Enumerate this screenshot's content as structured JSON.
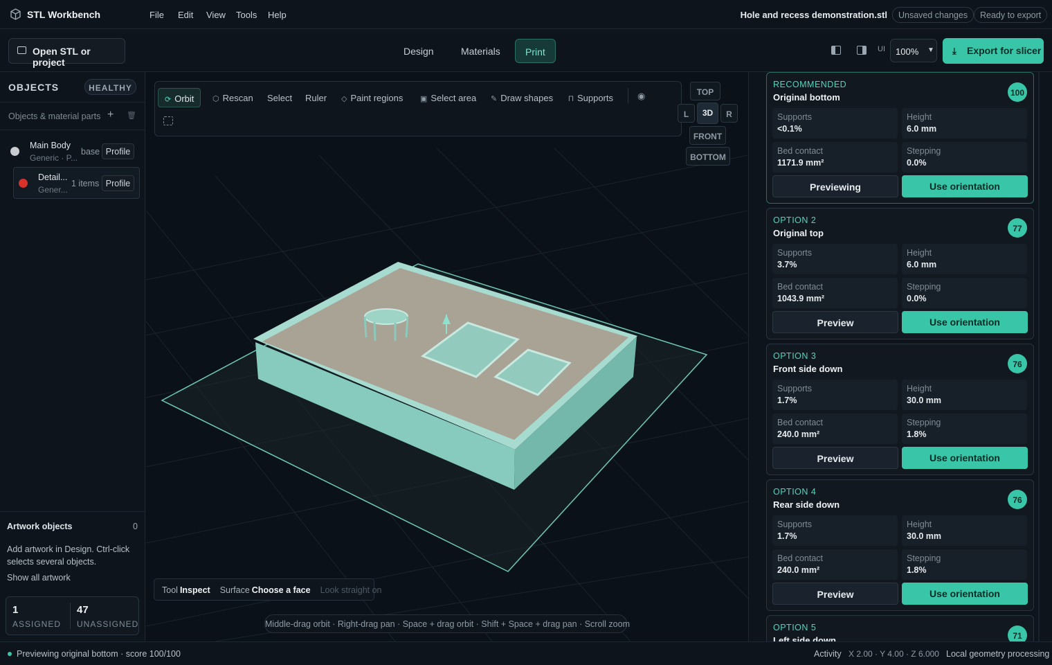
{
  "app": {
    "name": "STL Workbench",
    "file_name": "Hole and recess demonstration.stl",
    "unsaved": "Unsaved changes",
    "ready": "Ready to export"
  },
  "menu": [
    "File",
    "Edit",
    "View",
    "Tools",
    "Help"
  ],
  "toolbar": {
    "open_label": "Open STL or project",
    "tabs": [
      "Design",
      "Materials",
      "Print"
    ],
    "active_tab": "Print",
    "ui_label": "UI",
    "zoom": "100%",
    "export_label": "Export for slicer"
  },
  "sidebar": {
    "title": "OBJECTS",
    "health": "HEALTHY",
    "subtitle": "Objects & material parts",
    "objects": [
      {
        "name": "Main Body",
        "material": "Generic · P...",
        "tag": "base",
        "profile": "Profile",
        "color": "#c9cdd1"
      },
      {
        "name": "Detail...",
        "material": "Gener...",
        "tag": "1 items",
        "profile": "Profile",
        "color": "#d8322b"
      }
    ],
    "artwork": {
      "title": "Artwork objects",
      "count": "0",
      "help": "Add artwork in Design. Ctrl-click selects several objects.",
      "link": "Show all artwork"
    },
    "counts": {
      "assigned": "1",
      "assigned_label": "ASSIGNED",
      "unassigned": "47",
      "unassigned_label": "UNASSIGNED"
    }
  },
  "viewport": {
    "tools": [
      "Orbit",
      "Rescan",
      "Select",
      "Ruler",
      "Paint regions",
      "Select area",
      "Draw shapes",
      "Supports"
    ],
    "active_tool": "Orbit",
    "view_cube": {
      "top": "TOP",
      "left": "L",
      "center": "3D",
      "right": "R",
      "front": "FRONT",
      "bottom": "BOTTOM"
    },
    "status": {
      "tool_key": "Tool",
      "tool_val": "Inspect",
      "surface_key": "Surface",
      "surface_val": "Choose a face",
      "disabled": "Look straight on"
    },
    "hint": "Middle-drag orbit · Right-drag pan · Space + drag orbit · Shift + Space + drag pan · Scroll zoom"
  },
  "orientations": [
    {
      "tag": "RECOMMENDED",
      "title": "Original bottom",
      "score": "100",
      "supports": "<0.1%",
      "height": "6.0 mm",
      "bed": "1171.9 mm²",
      "stepping": "0.0%",
      "preview": "Previewing",
      "use": "Use orientation"
    },
    {
      "tag": "OPTION 2",
      "title": "Original top",
      "score": "77",
      "supports": "3.7%",
      "height": "6.0 mm",
      "bed": "1043.9 mm²",
      "stepping": "0.0%",
      "preview": "Preview",
      "use": "Use orientation"
    },
    {
      "tag": "OPTION 3",
      "title": "Front side down",
      "score": "76",
      "supports": "1.7%",
      "height": "30.0 mm",
      "bed": "240.0 mm²",
      "stepping": "1.8%",
      "preview": "Preview",
      "use": "Use orientation"
    },
    {
      "tag": "OPTION 4",
      "title": "Rear side down",
      "score": "76",
      "supports": "1.7%",
      "height": "30.0 mm",
      "bed": "240.0 mm²",
      "stepping": "1.8%",
      "preview": "Preview",
      "use": "Use orientation"
    },
    {
      "tag": "OPTION 5",
      "title": "Left side down",
      "score": "71"
    }
  ],
  "metric_labels": {
    "supports": "Supports",
    "height": "Height",
    "bed": "Bed contact",
    "stepping": "Stepping"
  },
  "statusbar": {
    "text": "Previewing original bottom · score 100/100",
    "activity": "Activity",
    "coords": "X 2.00 · Y 4.00 · Z 6.000",
    "mode": "Local geometry processing"
  },
  "colors": {
    "accent": "#39c6a8",
    "bg": "#0d131b",
    "panel": "#0e141c"
  }
}
